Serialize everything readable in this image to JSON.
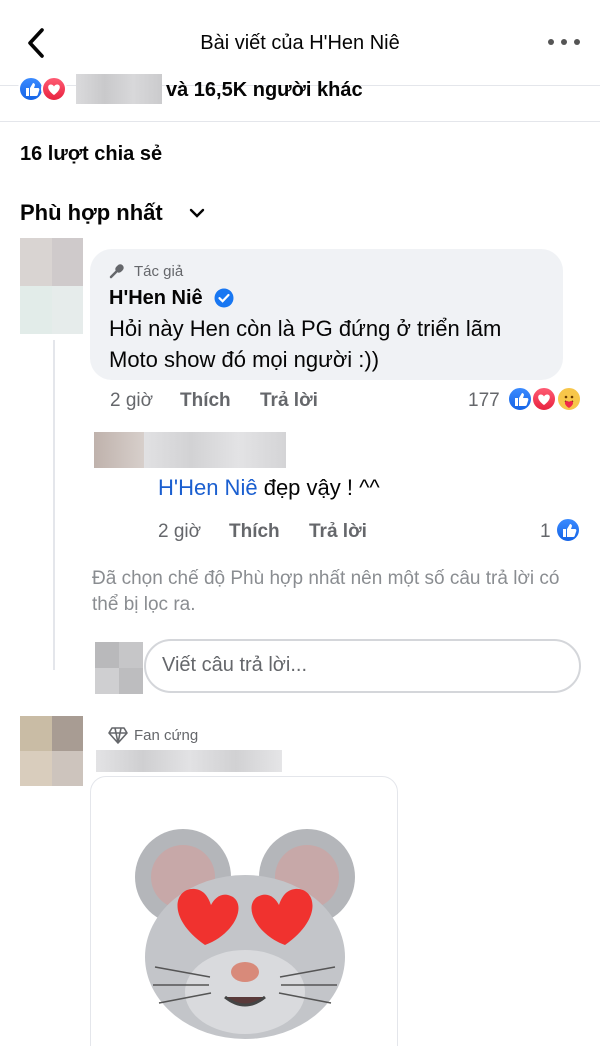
{
  "header": {
    "title": "Bài viết của H'Hen Niê"
  },
  "summary": {
    "reactions_text": "và 16,5K người khác",
    "shares_text": "16 lượt chia sẻ",
    "sort_label": "Phù hợp nhất"
  },
  "comment1": {
    "badge": "Tác giả",
    "author": "H'Hen Niê",
    "text_line1": "Hỏi này Hen còn là PG đứng ở triển lãm",
    "text_line2": "Moto show đó mọi người :))",
    "time": "2 giờ",
    "like_label": "Thích",
    "reply_label": "Trả lời",
    "reaction_count": "177"
  },
  "reply1": {
    "mention": "H'Hen Niê",
    "text": "đẹp vậy ! ^^",
    "time": "2 giờ",
    "like_label": "Thích",
    "reply_label": "Trả lời",
    "reaction_count": "1"
  },
  "notice": "Đã chọn chế độ Phù hợp nhất nên một số câu trả lời có thể bị lọc ra.",
  "reply_input": {
    "placeholder": "Viết câu trả lời..."
  },
  "comment2": {
    "badge": "Fan cứng"
  },
  "colors": {
    "like": "#1877f2",
    "love": "#f02849",
    "mention": "#1b5fd0",
    "bubble": "#f0f2f5"
  }
}
